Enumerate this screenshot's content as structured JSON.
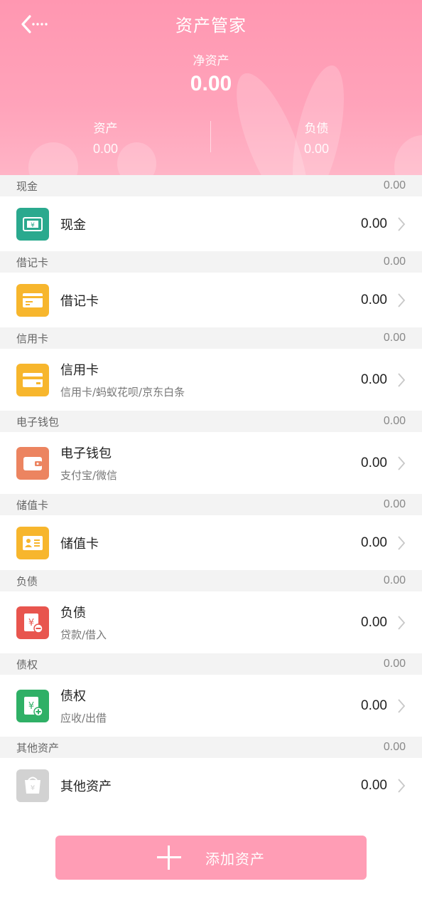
{
  "header": {
    "title": "资产管家",
    "net_assets_label": "净资产",
    "net_assets_value": "0.00",
    "assets_label": "资产",
    "assets_value": "0.00",
    "liabilities_label": "负债",
    "liabilities_value": "0.00"
  },
  "colors": {
    "header_pink": "#ff9db5",
    "cash": "#2aa98e",
    "debit": "#f7b62d",
    "credit": "#f7b62d",
    "ewallet": "#ec8460",
    "stored": "#f7b62d",
    "liability": "#e8554e",
    "claim": "#2fb066",
    "other": "#d2d2d2"
  },
  "sections": [
    {
      "header": "现金",
      "total": "0.00",
      "name": "现金",
      "sub": "",
      "amount": "0.00",
      "icon": "cash-icon"
    },
    {
      "header": "借记卡",
      "total": "0.00",
      "name": "借记卡",
      "sub": "",
      "amount": "0.00",
      "icon": "debit-card-icon"
    },
    {
      "header": "信用卡",
      "total": "0.00",
      "name": "信用卡",
      "sub": "信用卡/蚂蚁花呗/京东白条",
      "amount": "0.00",
      "icon": "credit-card-icon"
    },
    {
      "header": "电子钱包",
      "total": "0.00",
      "name": "电子钱包",
      "sub": "支付宝/微信",
      "amount": "0.00",
      "icon": "wallet-icon"
    },
    {
      "header": "储值卡",
      "total": "0.00",
      "name": "储值卡",
      "sub": "",
      "amount": "0.00",
      "icon": "stored-value-card-icon"
    },
    {
      "header": "负债",
      "total": "0.00",
      "name": "负债",
      "sub": "贷款/借入",
      "amount": "0.00",
      "icon": "liability-icon"
    },
    {
      "header": "债权",
      "total": "0.00",
      "name": "债权",
      "sub": "应收/出借",
      "amount": "0.00",
      "icon": "claim-icon"
    },
    {
      "header": "其他资产",
      "total": "0.00",
      "name": "其他资产",
      "sub": "",
      "amount": "0.00",
      "icon": "other-assets-icon"
    }
  ],
  "add_button": {
    "label": "添加资产"
  }
}
